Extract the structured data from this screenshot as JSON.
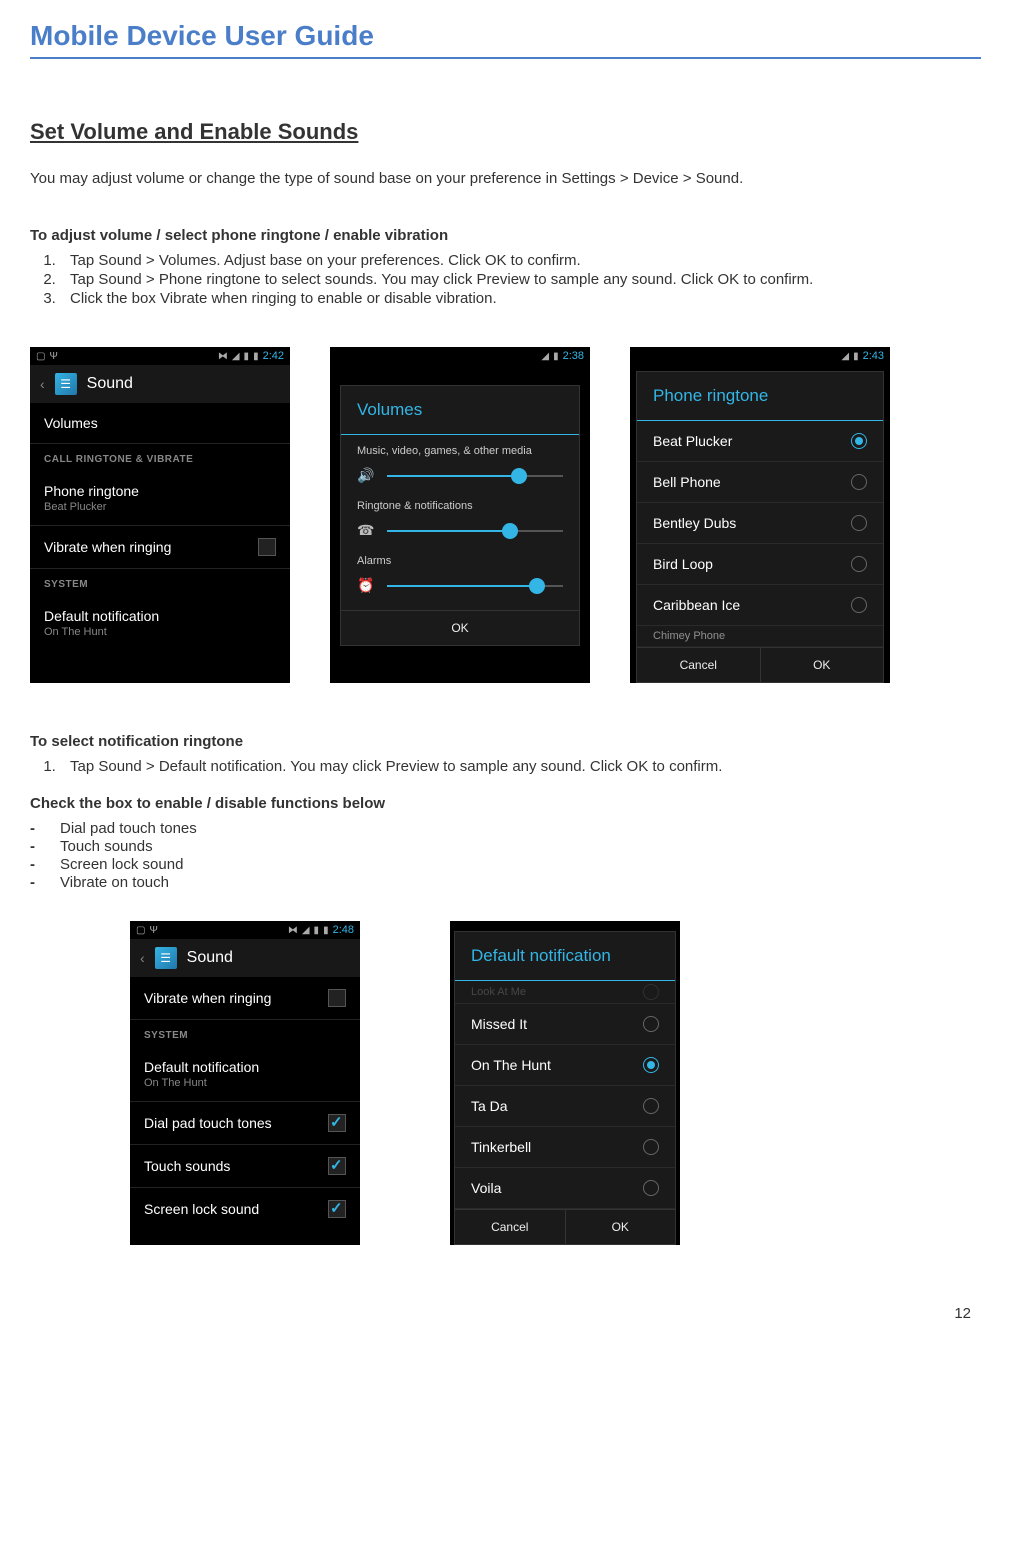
{
  "doc_title": "Mobile Device User Guide",
  "section_title": "Set Volume and Enable Sounds",
  "intro": "You may adjust volume or change the type of sound base on your preference in Settings > Device > Sound.",
  "sub1_heading": "To adjust volume / select phone ringtone / enable vibration",
  "steps1": [
    "Tap Sound > Volumes. Adjust base on your preferences. Click OK to confirm.",
    "Tap Sound > Phone ringtone to select sounds. You may click Preview to sample any sound. Click OK to confirm.",
    "Click the box Vibrate when ringing to enable or disable vibration."
  ],
  "sub2_heading": "To select notification ringtone",
  "steps2": [
    "Tap Sound > Default notification. You may click Preview to sample any sound. Click OK to confirm."
  ],
  "sub3_heading": "Check the box to enable / disable functions below",
  "dash_items": [
    "Dial pad touch tones",
    "Touch sounds",
    "Screen lock sound",
    "Vibrate on touch"
  ],
  "phone1": {
    "time": "2:42",
    "header": "Sound",
    "volumes": "Volumes",
    "cat1": "CALL RINGTONE & VIBRATE",
    "ringtone_label": "Phone ringtone",
    "ringtone_sub": "Beat Plucker",
    "vibrate": "Vibrate when ringing",
    "cat2": "SYSTEM",
    "notif_label": "Default notification",
    "notif_sub": "On The Hunt"
  },
  "phone2": {
    "time": "2:38",
    "dialog_title": "Volumes",
    "v1": "Music, video, games, & other media",
    "v2": "Ringtone & notifications",
    "v3": "Alarms",
    "ok": "OK"
  },
  "phone3": {
    "time": "2:43",
    "dialog_title": "Phone ringtone",
    "items": [
      "Beat Plucker",
      "Bell Phone",
      "Bentley Dubs",
      "Bird Loop",
      "Caribbean Ice"
    ],
    "cut": "Chimey Phone",
    "cancel": "Cancel",
    "ok": "OK"
  },
  "phone4": {
    "time": "2:48",
    "header": "Sound",
    "vibrate": "Vibrate when ringing",
    "cat": "SYSTEM",
    "notif_label": "Default notification",
    "notif_sub": "On The Hunt",
    "i1": "Dial pad touch tones",
    "i2": "Touch sounds",
    "i3": "Screen lock sound"
  },
  "phone5": {
    "dialog_title": "Default notification",
    "cut_top": "Look At Me",
    "items": [
      "Missed It",
      "On The Hunt",
      "Ta Da",
      "Tinkerbell",
      "Voila"
    ],
    "cancel": "Cancel",
    "ok": "OK"
  },
  "page_number": "12"
}
